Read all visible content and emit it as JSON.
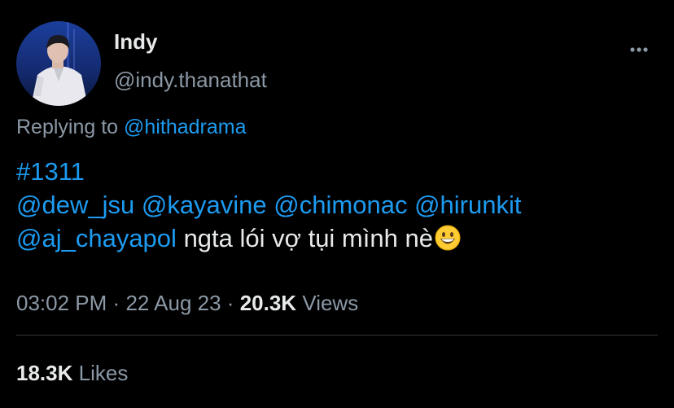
{
  "author": {
    "display_name": "Indy",
    "handle": "@indy.thanathat",
    "avatar_icon": "user-avatar-photo"
  },
  "reply": {
    "prefix": "Replying to",
    "mention": "@hithadrama"
  },
  "tweet": {
    "hashtag": "#1311",
    "mentions_line2": [
      "@dew_jsu",
      "@kayavine",
      "@chimonac",
      "@hirunkit"
    ],
    "mention_line3": "@aj_chayapol",
    "text_line3": "ngta lói vợ tụi mình nè",
    "emoji": "grinning-face-emoji"
  },
  "meta": {
    "time": "03:02 PM",
    "separator": "·",
    "date": "22 Aug 23",
    "views_count": "20.3K",
    "views_label": "Views"
  },
  "stats": {
    "likes_count": "18.3K",
    "likes_label": "Likes"
  },
  "colors": {
    "background": "#000000",
    "primary_text": "#e7e9ea",
    "secondary_text": "#8b98a5",
    "link": "#1d9bf0",
    "divider": "#2f3336"
  }
}
